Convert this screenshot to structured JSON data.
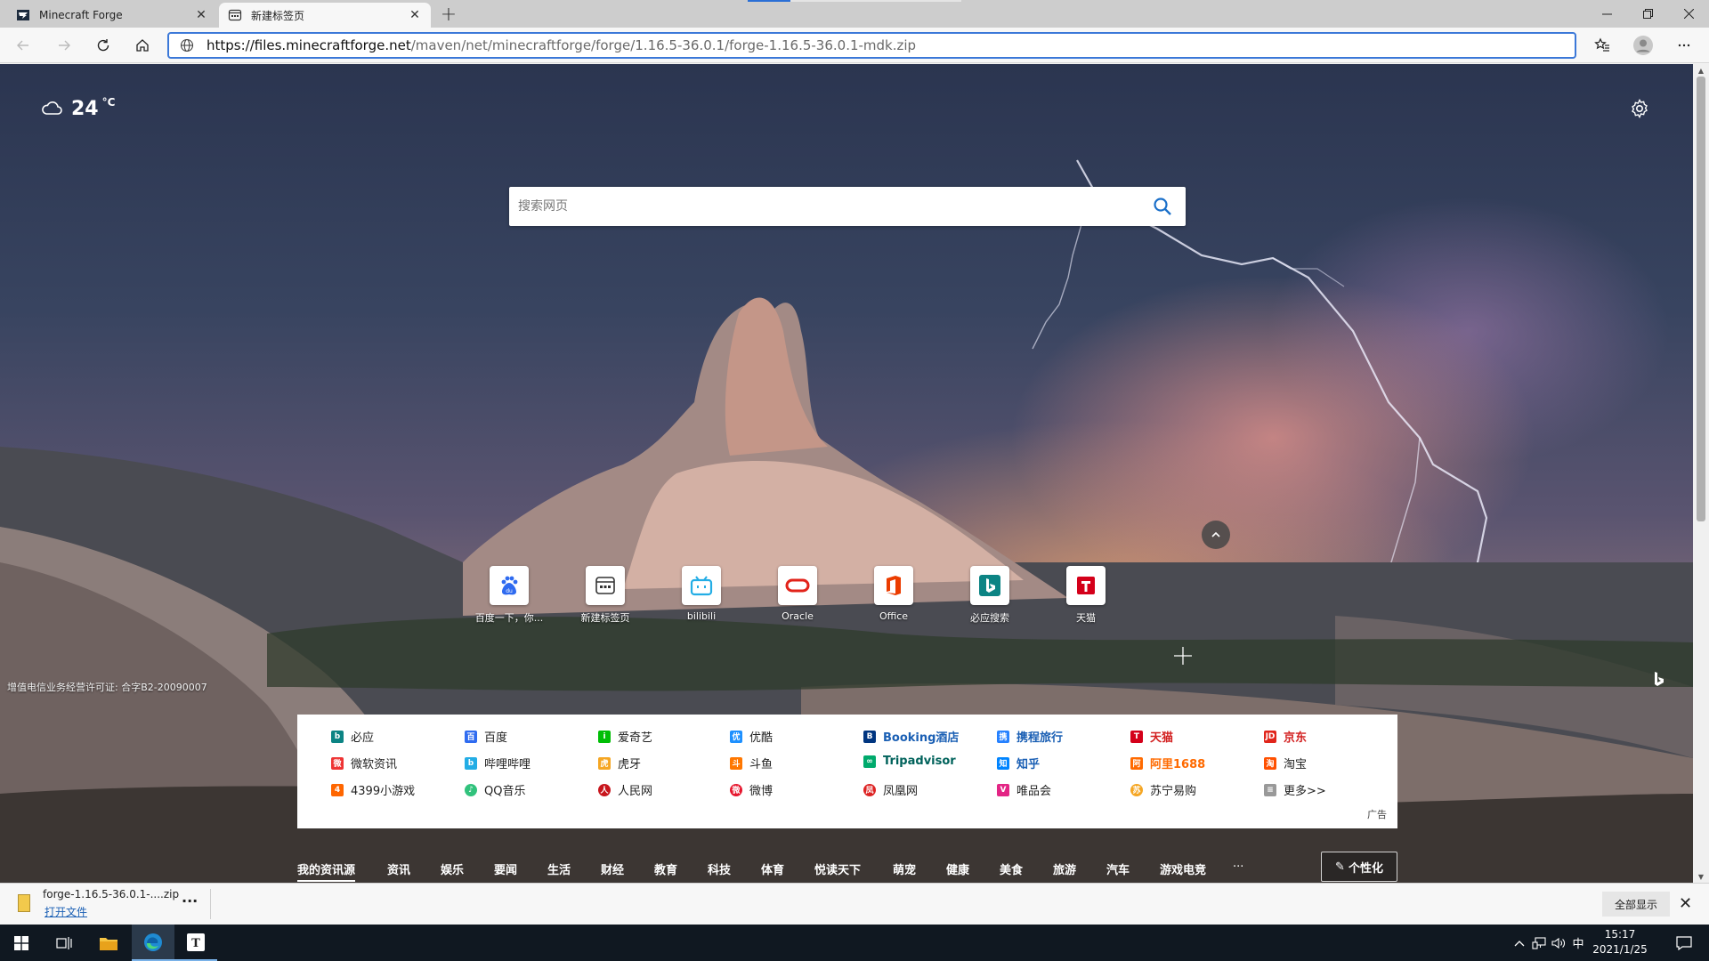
{
  "tabs": [
    {
      "title": "Minecraft Forge",
      "favicon": "minecraft-forge-icon"
    },
    {
      "title": "新建标签页",
      "favicon": "new-tab-icon"
    }
  ],
  "address": {
    "url_host": "https://files.minecraftforge.net",
    "url_rest": "/maven/net/minecraftforge/forge/1.16.5-36.0.1/forge-1.16.5-36.0.1-mdk.zip"
  },
  "weather": {
    "temp": "24",
    "unit": "°C",
    "icon": "cloud-icon"
  },
  "search": {
    "placeholder": "搜索网页"
  },
  "quick_links": [
    {
      "label": "百度一下，你...",
      "icon": "baidu-icon"
    },
    {
      "label": "新建标签页",
      "icon": "new-tab-icon"
    },
    {
      "label": "bilibili",
      "icon": "bilibili-icon"
    },
    {
      "label": "Oracle",
      "icon": "oracle-icon"
    },
    {
      "label": "Office",
      "icon": "office-icon"
    },
    {
      "label": "必应搜索",
      "icon": "bing-icon"
    },
    {
      "label": "天猫",
      "icon": "tmall-icon"
    }
  ],
  "license_text": "增值电信业务经营许可证: 合字B2-20090007",
  "link_grid": {
    "rows": [
      [
        "必应",
        "百度",
        "爱奇艺",
        "优酷",
        "Booking酒店",
        "携程旅行",
        "天猫",
        "京东"
      ],
      [
        "微软资讯",
        "哔哩哔哩",
        "虎牙",
        "斗鱼",
        "Tripadvisor",
        "知乎",
        "阿里1688",
        "淘宝"
      ],
      [
        "4399小游戏",
        "QQ音乐",
        "人民网",
        "微博",
        "凤凰网",
        "唯品会",
        "苏宁易购",
        "更多>>"
      ]
    ],
    "ad_label": "广告"
  },
  "categories": [
    "我的资讯源",
    "资讯",
    "娱乐",
    "要闻",
    "生活",
    "财经",
    "教育",
    "科技",
    "体育",
    "悦读天下",
    "萌宠",
    "健康",
    "美食",
    "旅游",
    "汽车",
    "游戏电竞",
    "···"
  ],
  "personalize_label": "个性化",
  "download": {
    "file_name": "forge-1.16.5-36.0.1-....zip",
    "open_label": "打开文件",
    "show_all_label": "全部显示"
  },
  "clock": {
    "time": "15:17",
    "date": "2021/1/25"
  },
  "tray": {
    "ime": "中"
  }
}
